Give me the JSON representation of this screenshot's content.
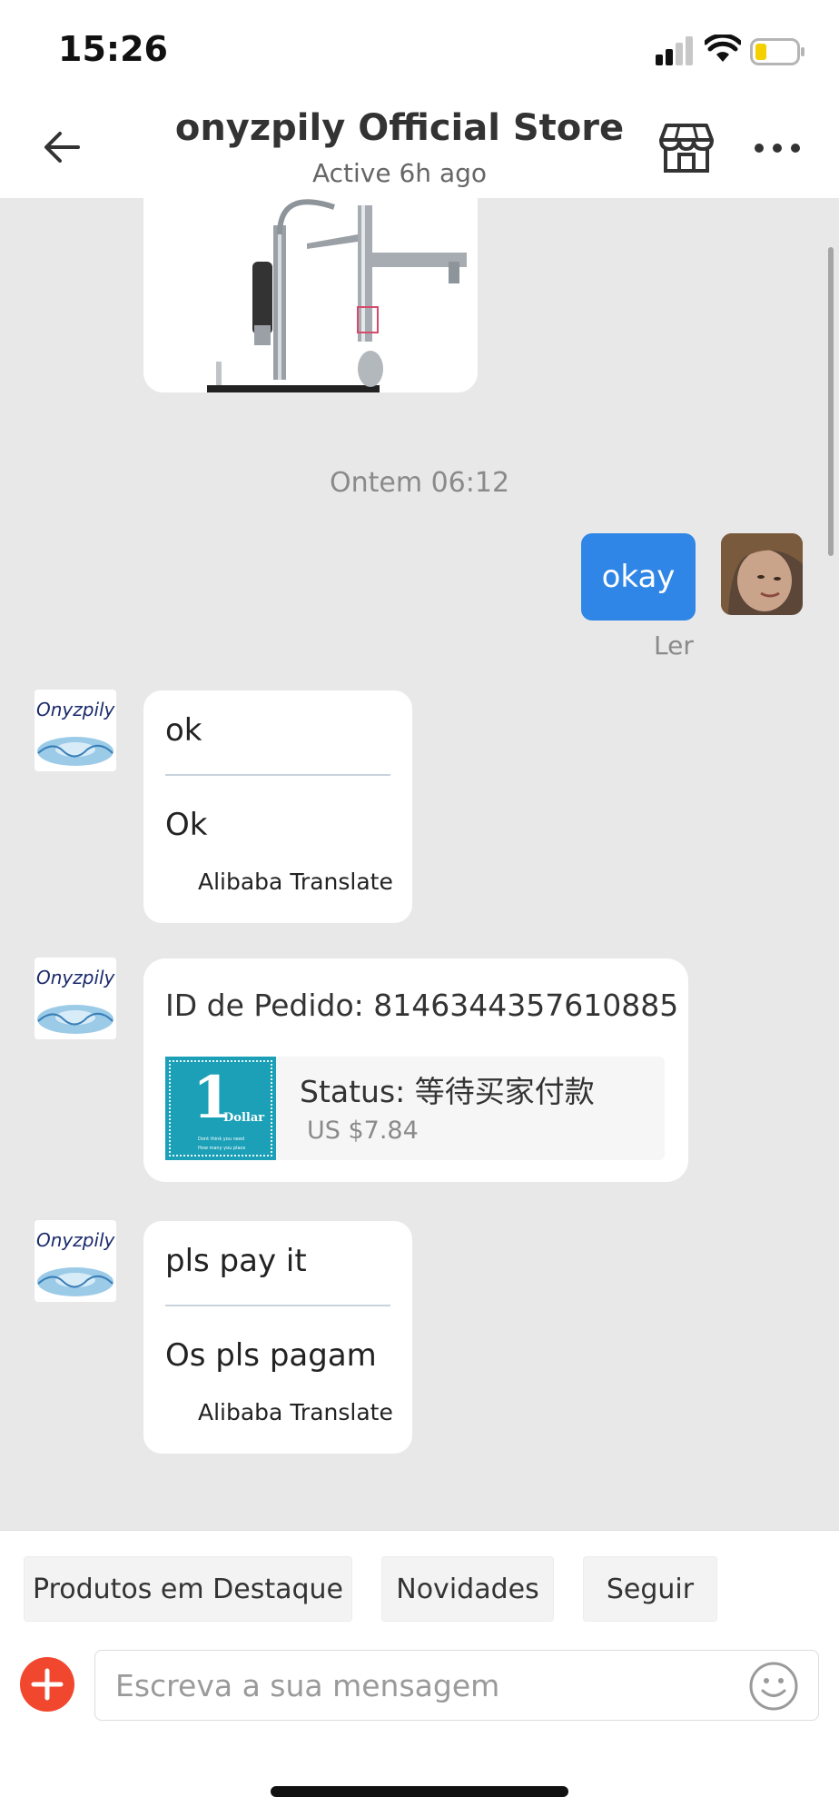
{
  "status_bar": {
    "time": "15:26"
  },
  "header": {
    "title": "onyzpily Official Store",
    "subtitle": "Active 6h ago"
  },
  "messages": {
    "timestamp": "Ontem 06:12",
    "sent": {
      "text": "okay",
      "status": "Ler"
    },
    "store_logo_text": "Onyzpily",
    "received_1": {
      "original": "ok",
      "translated": "Ok",
      "credit": "Alibaba Translate"
    },
    "order": {
      "id_text": "ID de Pedido: 8146344357610885",
      "status_text": "Status:  等待买家付款",
      "price": "US $7.84",
      "thumb_number": "1",
      "thumb_word": "Dollar",
      "thumb_caption_1": "Dont think you need",
      "thumb_caption_2": "How many you place"
    },
    "received_2": {
      "original": "pls pay it",
      "translated": "Os pls pagam",
      "credit": "Alibaba Translate"
    }
  },
  "quick_replies": [
    "Produtos em Destaque",
    "Novidades",
    "Seguir"
  ],
  "composer": {
    "placeholder": "Escreva a sua mensagem"
  },
  "colors": {
    "sent_bubble": "#2f86e6",
    "plus_button": "#f2472f",
    "chat_background": "#e8e8e8"
  }
}
